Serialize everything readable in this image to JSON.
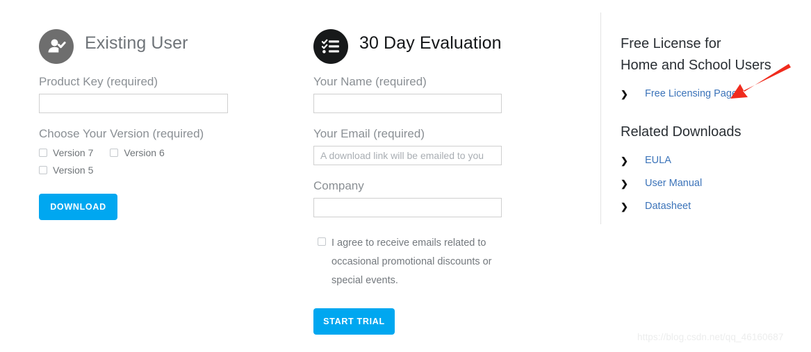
{
  "existing_user": {
    "title": "Existing User",
    "icon": "user-check-icon",
    "icon_circle_color": "#6e6e6e",
    "product_key_label": "Product Key (required)",
    "product_key_value": "",
    "product_key_placeholder": "",
    "version_label": "Choose Your Version (required)",
    "versions": [
      {
        "label": "Version 7",
        "checked": false
      },
      {
        "label": "Version 6",
        "checked": false
      },
      {
        "label": "Version 5",
        "checked": false
      }
    ],
    "download_button": "DOWNLOAD"
  },
  "evaluation": {
    "title": "30 Day Evaluation",
    "icon": "checklist-icon",
    "icon_circle_color": "#17191a",
    "name_label": "Your Name (required)",
    "name_value": "",
    "name_placeholder": "",
    "email_label": "Your Email (required)",
    "email_value": "",
    "email_placeholder": "A download link will be emailed to you",
    "company_label": "Company",
    "company_value": "",
    "company_placeholder": "",
    "consent_text": "I agree to receive emails related to occasional promotional discounts or special events.",
    "consent_checked": false,
    "start_trial_button": "START TRIAL"
  },
  "sidebar": {
    "free_license_title_line1": "Free License for",
    "free_license_title_line2": "Home and School Users",
    "free_license_link": "Free Licensing Page",
    "related_downloads_title": "Related Downloads",
    "downloads": [
      {
        "label": "EULA"
      },
      {
        "label": "User Manual"
      },
      {
        "label": "Datasheet"
      }
    ],
    "chevron_icon": "chevron-right-icon",
    "link_color": "#3b73b9"
  },
  "annotation": {
    "arrow_icon": "red-arrow-icon",
    "arrow_color": "#f02b1d"
  },
  "watermark": {
    "text": "https://blog.csdn.net/qq_46160687"
  },
  "theme": {
    "button_color": "#00a7f0",
    "divider_color": "#e2e2e2"
  }
}
